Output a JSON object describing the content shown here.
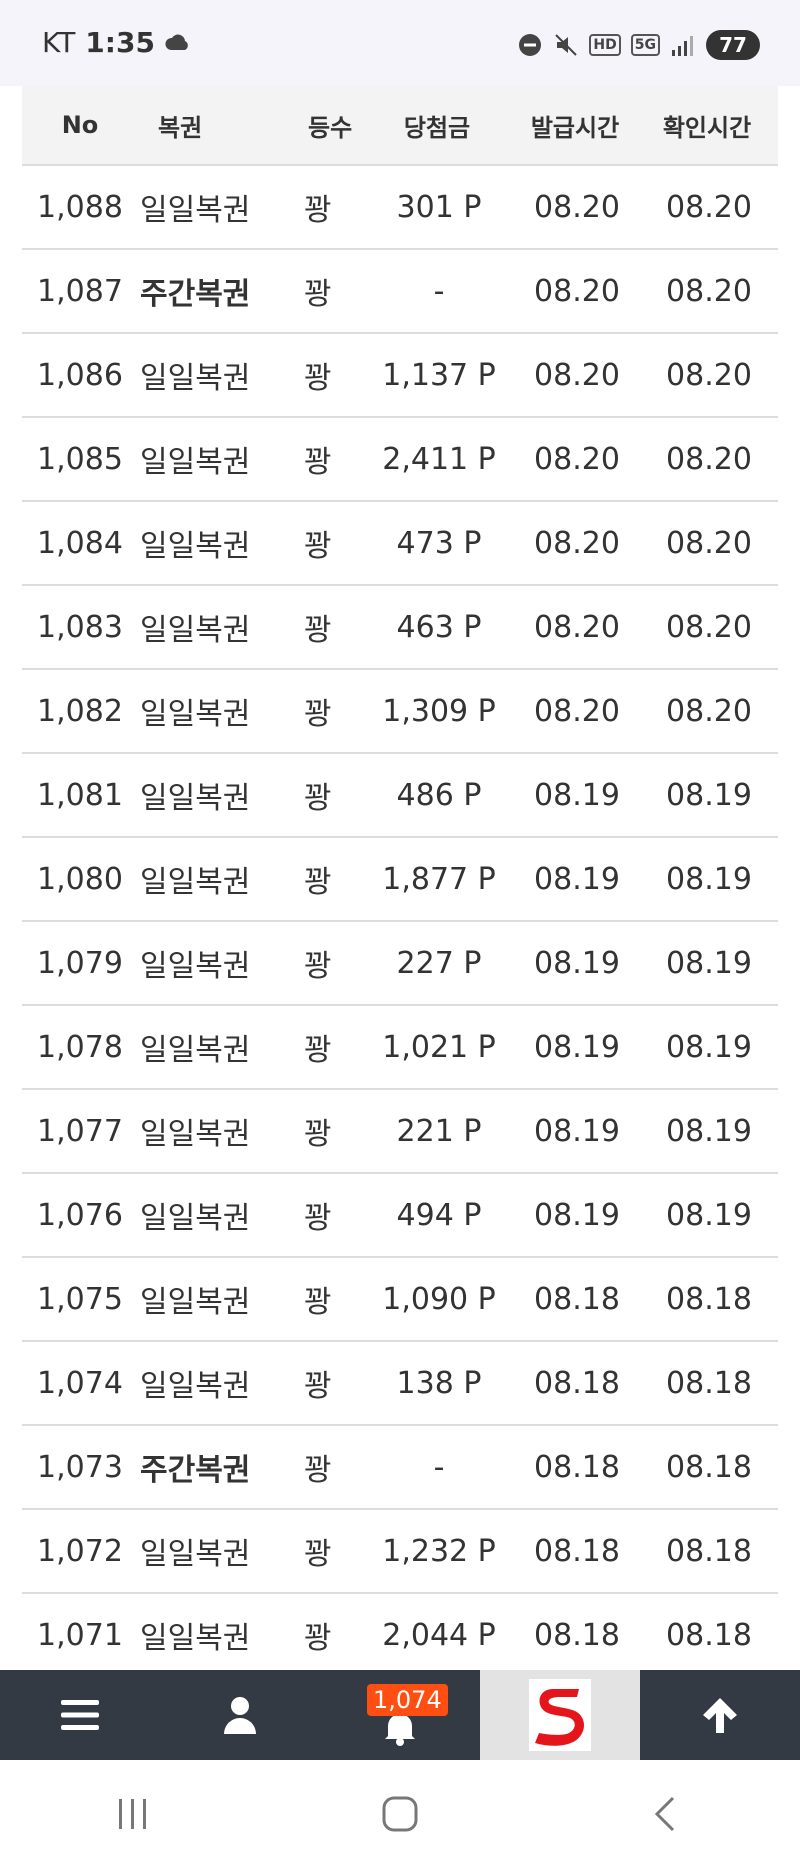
{
  "status_bar": {
    "carrier": "KT",
    "time": "1:35",
    "net_label": "5G",
    "hd_label": "HD",
    "battery": "77"
  },
  "table": {
    "headers": {
      "no": "No",
      "name": "복권",
      "rank": "등수",
      "prize": "당첨금",
      "issued": "발급시간",
      "checked": "확인시간"
    },
    "rows": [
      {
        "no": "1,088",
        "name": "일일복권",
        "rank": "꽝",
        "prize": "301 P",
        "issued": "08.20",
        "checked": "08.20"
      },
      {
        "no": "1,087",
        "name": "주간복권",
        "rank": "꽝",
        "prize": "-",
        "issued": "08.20",
        "checked": "08.20"
      },
      {
        "no": "1,086",
        "name": "일일복권",
        "rank": "꽝",
        "prize": "1,137 P",
        "issued": "08.20",
        "checked": "08.20"
      },
      {
        "no": "1,085",
        "name": "일일복권",
        "rank": "꽝",
        "prize": "2,411 P",
        "issued": "08.20",
        "checked": "08.20"
      },
      {
        "no": "1,084",
        "name": "일일복권",
        "rank": "꽝",
        "prize": "473 P",
        "issued": "08.20",
        "checked": "08.20"
      },
      {
        "no": "1,083",
        "name": "일일복권",
        "rank": "꽝",
        "prize": "463 P",
        "issued": "08.20",
        "checked": "08.20"
      },
      {
        "no": "1,082",
        "name": "일일복권",
        "rank": "꽝",
        "prize": "1,309 P",
        "issued": "08.20",
        "checked": "08.20"
      },
      {
        "no": "1,081",
        "name": "일일복권",
        "rank": "꽝",
        "prize": "486 P",
        "issued": "08.19",
        "checked": "08.19"
      },
      {
        "no": "1,080",
        "name": "일일복권",
        "rank": "꽝",
        "prize": "1,877 P",
        "issued": "08.19",
        "checked": "08.19"
      },
      {
        "no": "1,079",
        "name": "일일복권",
        "rank": "꽝",
        "prize": "227 P",
        "issued": "08.19",
        "checked": "08.19"
      },
      {
        "no": "1,078",
        "name": "일일복권",
        "rank": "꽝",
        "prize": "1,021 P",
        "issued": "08.19",
        "checked": "08.19"
      },
      {
        "no": "1,077",
        "name": "일일복권",
        "rank": "꽝",
        "prize": "221 P",
        "issued": "08.19",
        "checked": "08.19"
      },
      {
        "no": "1,076",
        "name": "일일복권",
        "rank": "꽝",
        "prize": "494 P",
        "issued": "08.19",
        "checked": "08.19"
      },
      {
        "no": "1,075",
        "name": "일일복권",
        "rank": "꽝",
        "prize": "1,090 P",
        "issued": "08.18",
        "checked": "08.18"
      },
      {
        "no": "1,074",
        "name": "일일복권",
        "rank": "꽝",
        "prize": "138 P",
        "issued": "08.18",
        "checked": "08.18"
      },
      {
        "no": "1,073",
        "name": "주간복권",
        "rank": "꽝",
        "prize": "-",
        "issued": "08.18",
        "checked": "08.18"
      },
      {
        "no": "1,072",
        "name": "일일복권",
        "rank": "꽝",
        "prize": "1,232 P",
        "issued": "08.18",
        "checked": "08.18"
      },
      {
        "no": "1,071",
        "name": "일일복권",
        "rank": "꽝",
        "prize": "2,044 P",
        "issued": "08.18",
        "checked": "08.18"
      }
    ]
  },
  "bottom_nav": {
    "items": [
      {
        "icon": "menu-icon"
      },
      {
        "icon": "user-icon"
      },
      {
        "icon": "bell-icon",
        "badge": "1,074"
      },
      {
        "icon": "logo-s"
      },
      {
        "icon": "arrow-up-icon"
      }
    ],
    "badge_color": "#ff4e12",
    "bar_color": "#333a44"
  },
  "system_nav": {
    "items": [
      "recent-apps-icon",
      "home-icon",
      "back-icon"
    ]
  }
}
